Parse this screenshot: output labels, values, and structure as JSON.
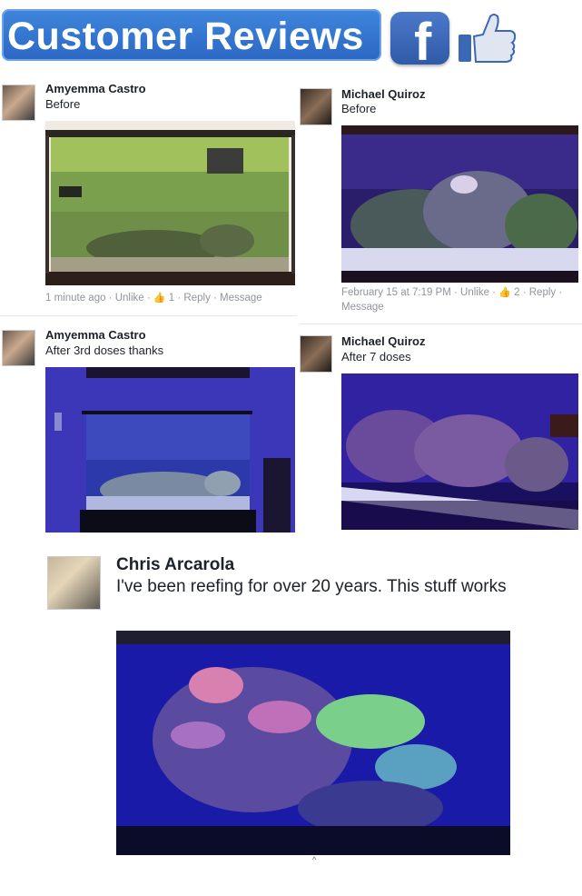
{
  "header": {
    "title": "Customer Reviews",
    "facebook_letter": "f",
    "brand_color": "#3b73d1"
  },
  "posts": [
    {
      "author": "Amyemma Castro",
      "caption": "Before",
      "meta": "1 minute ago · Unlike · ",
      "likes": "1",
      "actions": " · Reply · Message",
      "photo": "green-algae-aquarium"
    },
    {
      "author": "Michael Quiroz",
      "caption": "Before",
      "meta": "February 15 at 7:19 PM · Unlike · ",
      "likes": "2",
      "actions": " · Reply ·",
      "actions_line2": "Message",
      "photo": "blue-lit-reef-tank"
    },
    {
      "author": "Amyemma Castro",
      "caption": "After 3rd doses thanks",
      "photo": "clean-blue-aquarium"
    },
    {
      "author": "Michael Quiroz",
      "caption": "After 7 doses",
      "photo": "purple-coral-tank"
    }
  ],
  "featured": {
    "author": "Chris Arcarola",
    "caption": "I've been reefing for over 20 years. This stuff works",
    "photo": "colorful-coral-reef"
  },
  "icons": {
    "facebook": "facebook-icon",
    "like": "thumbs-up-icon"
  }
}
